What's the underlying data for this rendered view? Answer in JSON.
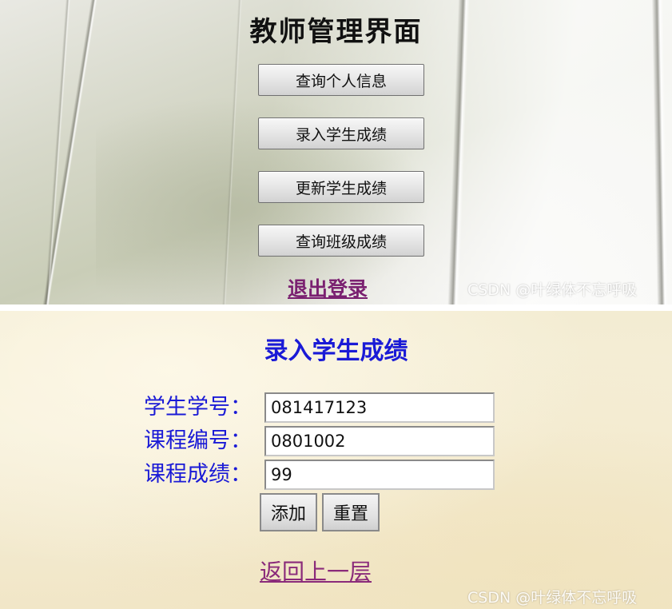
{
  "teacher_panel": {
    "title": "教师管理界面",
    "menu": [
      {
        "label": "查询个人信息"
      },
      {
        "label": "录入学生成绩"
      },
      {
        "label": "更新学生成绩"
      },
      {
        "label": "查询班级成绩"
      }
    ],
    "logout_label": "退出登录",
    "watermark": "CSDN @叶绿体不忘呼吸"
  },
  "score_form": {
    "title": "录入学生成绩",
    "fields": [
      {
        "label": "学生学号：",
        "value": "081417123"
      },
      {
        "label": "课程编号：",
        "value": "0801002"
      },
      {
        "label": "课程成绩：",
        "value": "99"
      }
    ],
    "add_label": "添加",
    "reset_label": "重置",
    "back_label": "返回上一层",
    "watermark": "CSDN @叶绿体不忘呼吸"
  },
  "colors": {
    "form_label": "#1a1ad6",
    "link": "#7a2070"
  }
}
